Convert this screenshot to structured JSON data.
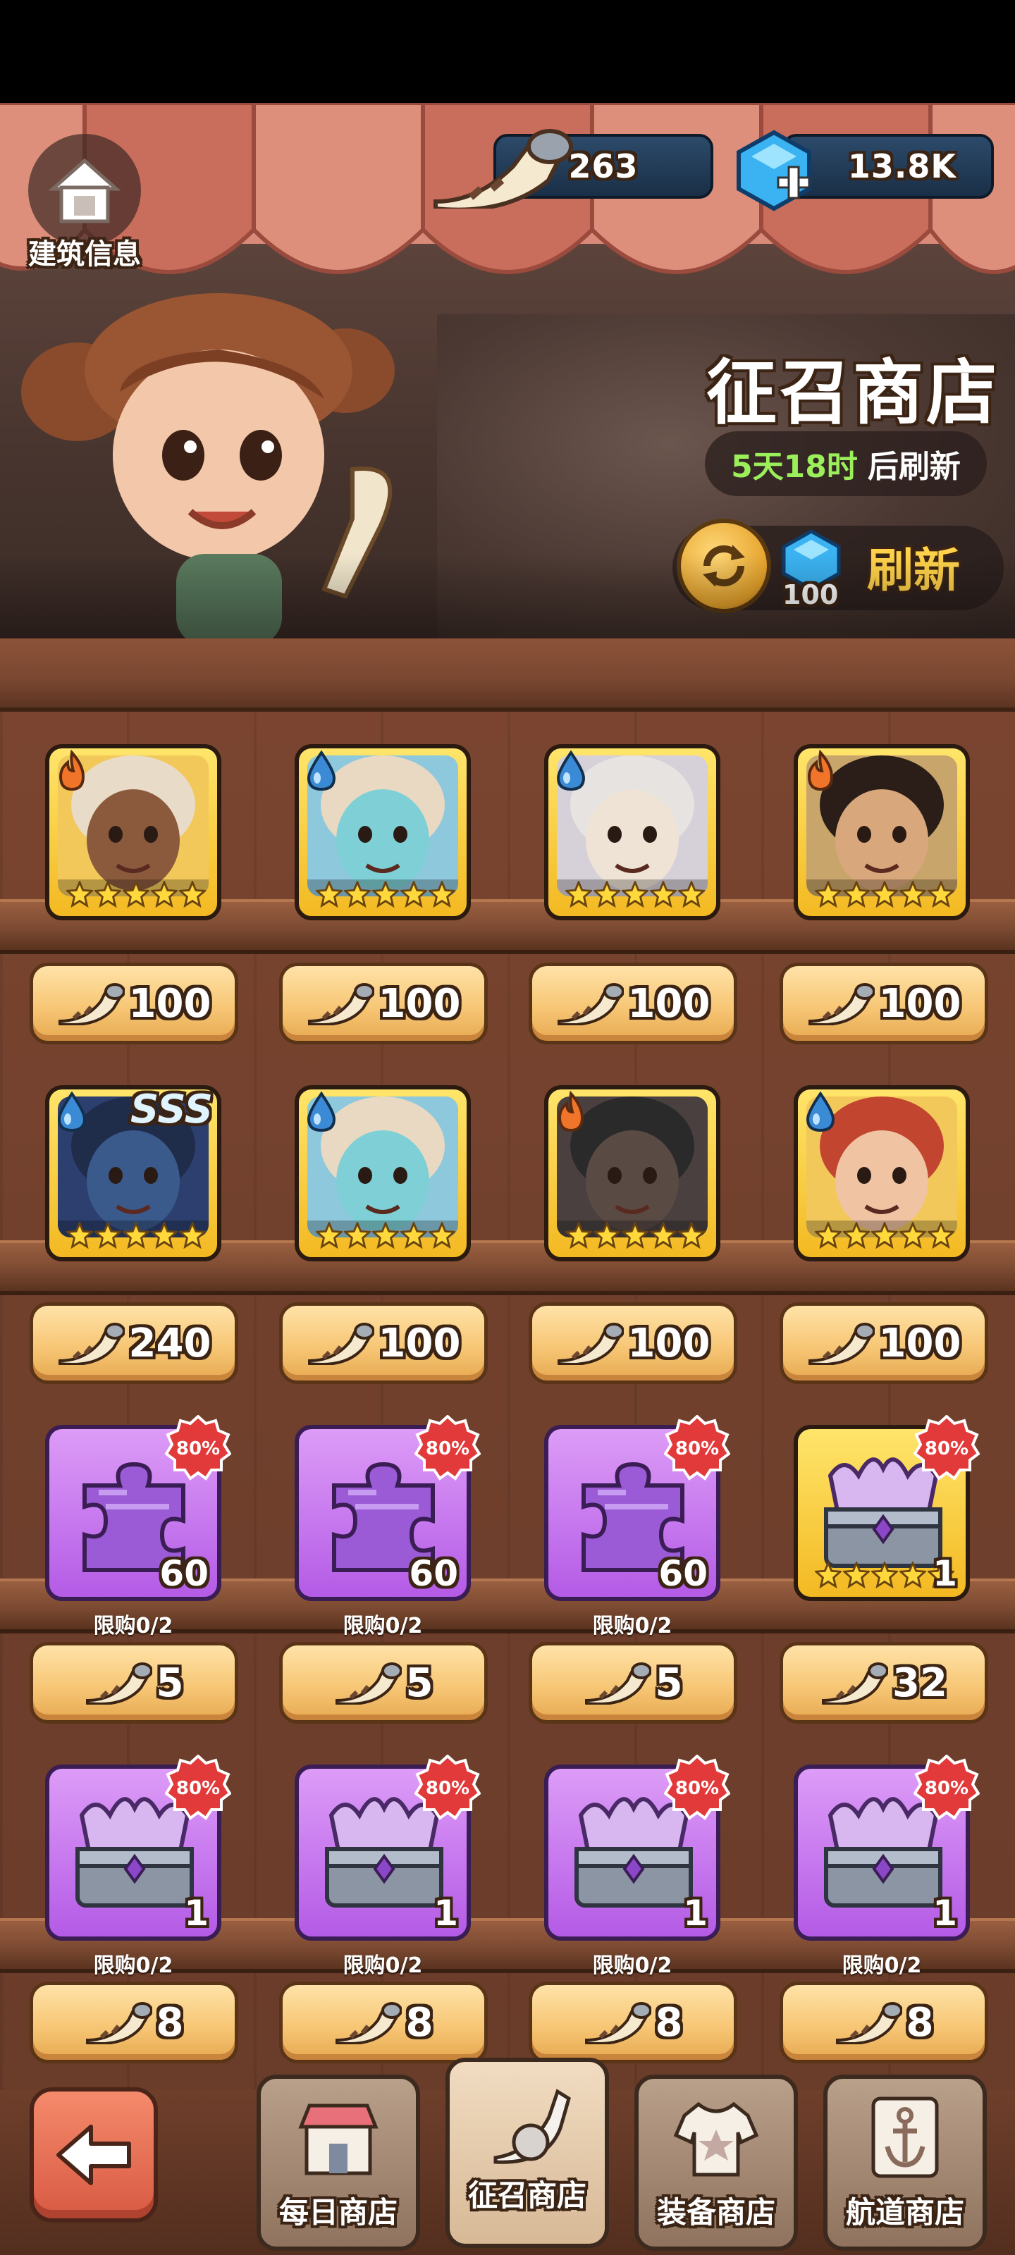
{
  "header": {
    "building_info_label": "建筑信息",
    "currencies": [
      {
        "name": "horn",
        "value": "263"
      },
      {
        "name": "gem",
        "value": "13.8K"
      }
    ],
    "shop_title": "征召商店",
    "refresh_time_value": "5天18时",
    "refresh_time_suffix": "后刷新",
    "refresh_cost": "100",
    "refresh_label": "刷新"
  },
  "items": [
    {
      "kind": "hero",
      "element": "fire",
      "stars": 5,
      "price": "100"
    },
    {
      "kind": "hero",
      "element": "water",
      "stars": 5,
      "price": "100"
    },
    {
      "kind": "hero",
      "element": "water",
      "stars": 5,
      "price": "100"
    },
    {
      "kind": "hero",
      "element": "fire",
      "stars": 5,
      "price": "100"
    },
    {
      "kind": "hero",
      "element": "water",
      "stars": 5,
      "badge": "SSS",
      "price": "240"
    },
    {
      "kind": "hero",
      "element": "water",
      "stars": 5,
      "price": "100"
    },
    {
      "kind": "hero",
      "element": "fire",
      "stars": 5,
      "price": "100"
    },
    {
      "kind": "hero",
      "element": "water",
      "stars": 5,
      "price": "100"
    },
    {
      "kind": "shard",
      "qty": "60",
      "discount": "80%",
      "limit": "限购0/2",
      "price": "5"
    },
    {
      "kind": "shard",
      "qty": "60",
      "discount": "80%",
      "limit": "限购0/2",
      "price": "5"
    },
    {
      "kind": "shard",
      "qty": "60",
      "discount": "80%",
      "limit": "限购0/2",
      "price": "5"
    },
    {
      "kind": "chest-gold",
      "qty": "1",
      "stars": 5,
      "discount": "80%",
      "limit": "",
      "price": "32"
    },
    {
      "kind": "chest",
      "qty": "1",
      "discount": "80%",
      "limit": "限购0/2",
      "price": "8"
    },
    {
      "kind": "chest",
      "qty": "1",
      "discount": "80%",
      "limit": "限购0/2",
      "price": "8"
    },
    {
      "kind": "chest",
      "qty": "1",
      "discount": "80%",
      "limit": "限购0/2",
      "price": "8"
    },
    {
      "kind": "chest",
      "qty": "1",
      "discount": "80%",
      "limit": "限购0/2",
      "price": "8"
    }
  ],
  "nav": {
    "back_icon": "arrow-left-icon",
    "tabs": [
      {
        "label": "每日商店",
        "icon": "store-icon",
        "active": false
      },
      {
        "label": "征召商店",
        "icon": "horn-icon",
        "active": true
      },
      {
        "label": "装备商店",
        "icon": "shirt-icon",
        "active": false
      },
      {
        "label": "航道商店",
        "icon": "anchor-icon",
        "active": false
      }
    ]
  },
  "colors": {
    "time_green": "#9bef5b",
    "refresh_yellow": "#ffd24a",
    "fire": "#f0752a",
    "water": "#3b8ad6"
  }
}
